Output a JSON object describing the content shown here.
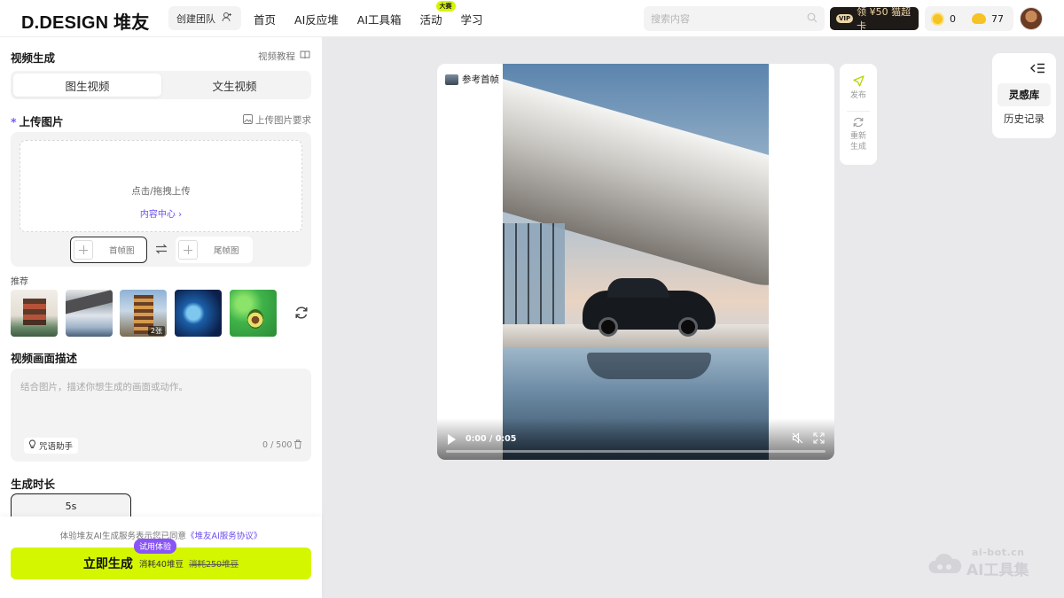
{
  "header": {
    "logo": "D.DESIGN 堆友",
    "team_label": "创建团队",
    "nav": [
      {
        "label": "首页"
      },
      {
        "label": "AI反应堆"
      },
      {
        "label": "AI工具箱"
      },
      {
        "label": "活动",
        "badge": "大赛"
      },
      {
        "label": "学习"
      }
    ],
    "search_placeholder": "搜索内容",
    "vip_tag": "VIP",
    "vip_label": "领 ¥50 猫超卡",
    "coins_a": "0",
    "coins_b": "77"
  },
  "panel": {
    "title": "视频生成",
    "tutorial": "视频教程",
    "tabs": [
      {
        "label": "图生视频",
        "active": true
      },
      {
        "label": "文生视频",
        "active": false
      }
    ],
    "upload": {
      "title": "上传图片",
      "requirements": "上传图片要求",
      "hint": "点击/拖拽上传",
      "content_center": "内容中心",
      "first_frame": "首帧图",
      "last_frame": "尾帧图"
    },
    "recommend": {
      "label": "推荐",
      "third_count": "2张"
    },
    "description": {
      "title": "视频画面描述",
      "placeholder": "结合图片，描述你想生成的画面或动作。",
      "helper": "咒语助手",
      "counter": "0 / 500"
    },
    "duration": {
      "title": "生成时长",
      "selected": "5s"
    },
    "footer": {
      "agree_prefix": "体验堆友AI生成服务表示您已同意",
      "agree_link": "《堆友AI服务协议》",
      "trial_badge": "试用体验",
      "generate": "立即生成",
      "cost": "消耗40堆豆",
      "old_cost": "消耗250堆豆"
    }
  },
  "preview": {
    "reference_label": "参考首帧",
    "time": "0:00 / 0:05",
    "progress": 0
  },
  "actions": {
    "publish": "发布",
    "regenerate_1": "重新",
    "regenerate_2": "生成"
  },
  "right_panel": {
    "items": [
      {
        "label": "灵感库",
        "active": true
      },
      {
        "label": "历史记录",
        "active": false
      }
    ]
  },
  "watermark": {
    "small": "ai-bot.cn",
    "big": "AI工具集"
  },
  "colors": {
    "accent": "#d4f700",
    "purple": "#6a4cf0",
    "trial": "#8a55f6"
  }
}
